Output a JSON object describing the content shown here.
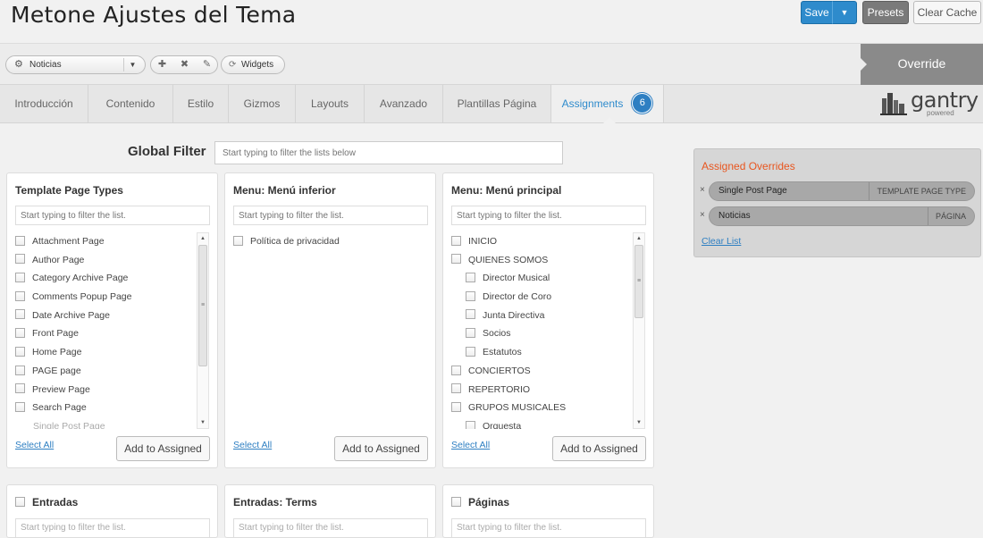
{
  "header": {
    "title": "Metone Ajustes del Tema",
    "save_label": "Save",
    "save_caret": "▼",
    "presets_label": "Presets",
    "clear_cache_label": "Clear Cache"
  },
  "toolbar": {
    "override_select": "Noticias",
    "widgets_label": "Widgets",
    "override_label": "Override",
    "icons": [
      "gear-icon",
      "add-icon",
      "delete-icon",
      "edit-icon",
      "widgets-icon"
    ]
  },
  "tabs": [
    {
      "label": "Introducción"
    },
    {
      "label": "Contenido"
    },
    {
      "label": "Estilo"
    },
    {
      "label": "Gizmos"
    },
    {
      "label": "Layouts"
    },
    {
      "label": "Avanzado"
    },
    {
      "label": "Plantillas Página"
    },
    {
      "label": "Assignments",
      "badge": "6",
      "active": true
    }
  ],
  "logo": {
    "word": "gantry",
    "sub": "powered"
  },
  "global_filter": {
    "label": "Global Filter",
    "placeholder": "Start typing to filter the lists below"
  },
  "panels": [
    {
      "title": "Template Page Types",
      "placeholder": "Start typing to filter the list.",
      "items": [
        "Attachment Page",
        "Author Page",
        "Category Archive Page",
        "Comments Popup Page",
        "Date Archive Page",
        "Front Page",
        "Home Page",
        "PAGE page",
        "Preview Page",
        "Search Page",
        "Single Post Page"
      ],
      "select_all": "Select All",
      "add_button": "Add to Assigned"
    },
    {
      "title": "Menu: Menú inferior",
      "placeholder": "Start typing to filter the list.",
      "items": [
        "Política de privacidad"
      ],
      "select_all": "Select All",
      "add_button": "Add to Assigned"
    },
    {
      "title": "Menu: Menú principal",
      "placeholder": "Start typing to filter the list.",
      "items": [
        "INICIO",
        "QUIENES SOMOS",
        "Director Musical",
        "Director de Coro",
        "Junta Directiva",
        "Socios",
        "Estatutos",
        "CONCIERTOS",
        "REPERTORIO",
        "GRUPOS MUSICALES",
        "Orquesta"
      ],
      "select_all": "Select All",
      "add_button": "Add to Assigned"
    }
  ],
  "bottom_panels": [
    {
      "title": "Entradas",
      "placeholder": "Start typing to filter the list."
    },
    {
      "title": "Entradas: Terms",
      "placeholder": "Start typing to filter the list."
    },
    {
      "title": "Páginas",
      "placeholder": "Start typing to filter the list."
    }
  ],
  "assigned": {
    "title": "Assigned Overrides",
    "items": [
      {
        "name": "Single Post Page",
        "type": "TEMPLATE PAGE TYPE"
      },
      {
        "name": "Noticias",
        "type": "PÁGINA"
      }
    ],
    "clear_label": "Clear List",
    "remove_glyph": "×"
  },
  "colors": {
    "accent": "#2e8bcc",
    "override_gray": "#8a8a8a",
    "assigned_title": "#e8561f",
    "link": "#2e7fc2"
  }
}
